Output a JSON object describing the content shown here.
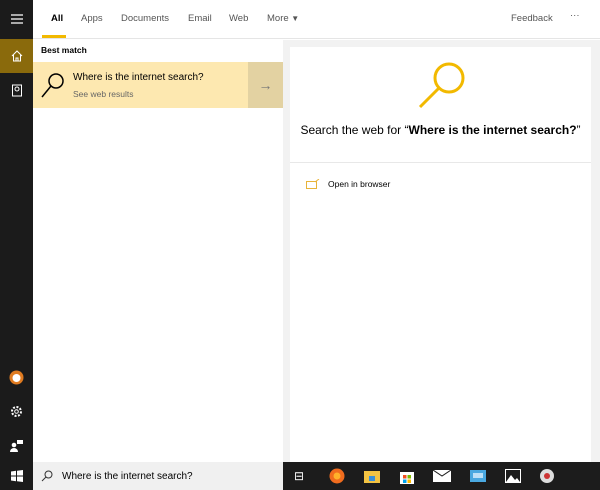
{
  "tabs": {
    "all": "All",
    "apps": "Apps",
    "documents": "Documents",
    "email": "Email",
    "web": "Web",
    "more": "More",
    "feedback": "Feedback",
    "ellipsis": "···"
  },
  "left": {
    "section": "Best match",
    "result_title": "Where is the internet search?",
    "result_sub": "See web results"
  },
  "right": {
    "prefix": "Search the web for “",
    "query": "Where is the internet search?",
    "suffix": "”",
    "open_browser": "Open in browser"
  },
  "search": {
    "value": "Where is the internet search?"
  },
  "colors": {
    "accent": "#f2b900",
    "sidebar_active": "#8a6a0c"
  }
}
